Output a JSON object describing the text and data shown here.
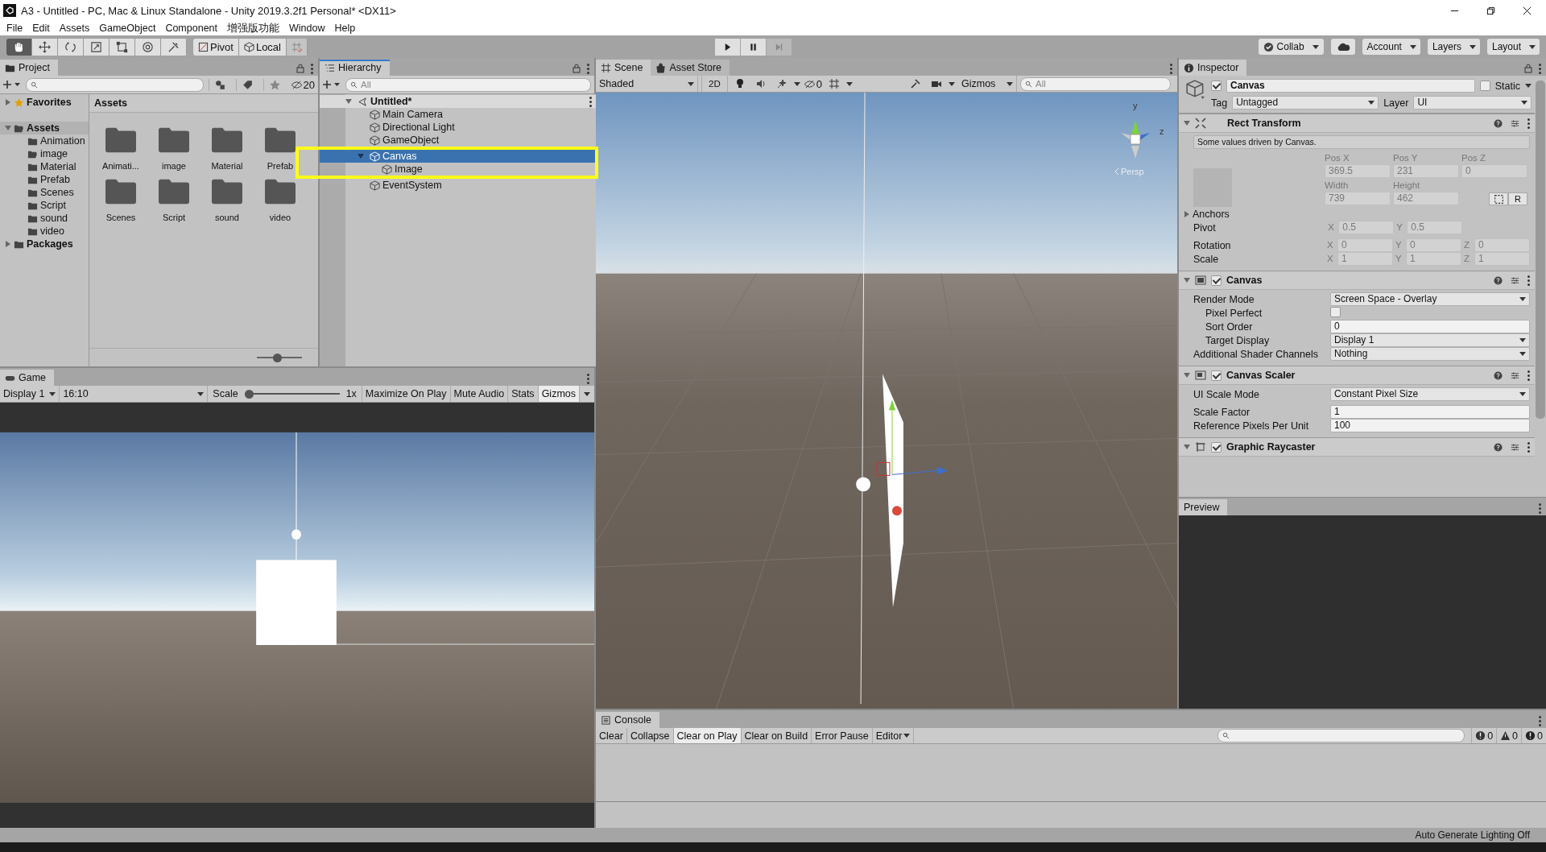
{
  "window": {
    "title": "A3 - Untitled - PC, Mac & Linux Standalone - Unity 2019.3.2f1 Personal* <DX11>"
  },
  "menu": [
    "File",
    "Edit",
    "Assets",
    "GameObject",
    "Component",
    "增强版功能",
    "Window",
    "Help"
  ],
  "toolbar": {
    "tools": [
      {
        "kind": "hand",
        "selected": true
      },
      {
        "kind": "move",
        "selected": false
      },
      {
        "kind": "rotate",
        "selected": false
      },
      {
        "kind": "scale",
        "selected": false
      },
      {
        "kind": "rect",
        "selected": false
      },
      {
        "kind": "transform",
        "selected": false
      },
      {
        "kind": "custom",
        "selected": false
      }
    ],
    "handles": [
      {
        "kind": "pivot",
        "label": "Pivot"
      },
      {
        "kind": "local",
        "label": "Local"
      }
    ],
    "snap": {
      "disabled": true
    },
    "play": [
      {
        "kind": "play",
        "disabled": false
      },
      {
        "kind": "pause",
        "disabled": false
      },
      {
        "kind": "step",
        "disabled": true
      }
    ],
    "right": [
      {
        "kind": "collab",
        "label": "Collab"
      },
      {
        "kind": "cloud"
      },
      {
        "kind": "dropdown",
        "label": "Account"
      },
      {
        "kind": "dropdown",
        "label": "Layers"
      },
      {
        "kind": "dropdown",
        "label": "Layout"
      }
    ]
  },
  "project": {
    "tab": "Project",
    "hidden_count": "20",
    "sidebar": [
      {
        "label": "Favorites",
        "kind": "favorites",
        "expanded": false,
        "selected": false
      },
      {
        "label": "Assets",
        "kind": "folder",
        "expanded": true,
        "selected": true,
        "children": [
          {
            "label": "Animation",
            "kind": "folder",
            "selected": false
          },
          {
            "label": "image",
            "kind": "open-folder",
            "selected": false
          },
          {
            "label": "Material",
            "kind": "folder",
            "selected": false
          },
          {
            "label": "Prefab",
            "kind": "folder",
            "selected": false
          },
          {
            "label": "Scenes",
            "kind": "folder",
            "selected": false
          },
          {
            "label": "Script",
            "kind": "folder",
            "selected": false
          },
          {
            "label": "sound",
            "kind": "folder",
            "selected": false
          },
          {
            "label": "video",
            "kind": "folder",
            "selected": false
          }
        ]
      },
      {
        "label": "Packages",
        "kind": "folder",
        "expanded": false,
        "selected": false
      }
    ],
    "breadcrumb": "Assets",
    "items": [
      "Animati...",
      "image",
      "Material",
      "Prefab",
      "Scenes",
      "Script",
      "sound",
      "video"
    ],
    "zoom": {
      "level": 0.45
    }
  },
  "hierarchy": {
    "tab": "Hierarchy",
    "search_placeholder": "All",
    "tree": [
      {
        "label": "Untitled*",
        "kind": "scene",
        "expanded": true,
        "selected": false,
        "children": [
          {
            "label": "Main Camera",
            "kind": "object",
            "selected": false
          },
          {
            "label": "Directional Light",
            "kind": "object",
            "selected": false
          },
          {
            "label": "GameObject",
            "kind": "object",
            "selected": false
          },
          {
            "label": "Canvas",
            "kind": "object",
            "selected": true,
            "expanded": true,
            "children": [
              {
                "label": "Image",
                "kind": "object",
                "selected": false
              }
            ]
          },
          {
            "label": "EventSystem",
            "kind": "object",
            "selected": false
          }
        ]
      }
    ]
  },
  "scene": {
    "tabs": [
      {
        "label": "Scene",
        "kind": "scene",
        "selected": true
      },
      {
        "label": "Asset Store",
        "kind": "store",
        "selected": false
      }
    ],
    "shading": "Shaded",
    "mode_2d": {
      "label": "2D",
      "selected": false
    },
    "hidden_count": "0",
    "gizmos": "Gizmos",
    "search_placeholder": "All",
    "persp": "Persp",
    "axes": [
      "y",
      "z"
    ]
  },
  "game": {
    "tab": "Game",
    "display": "Display 1",
    "aspect": "16:10",
    "scale_label": "Scale",
    "scale": {
      "level": 0.0
    },
    "scale_value": "1x",
    "toggles": [
      {
        "label": "Maximize On Play",
        "selected": false
      },
      {
        "label": "Mute Audio",
        "selected": false
      },
      {
        "label": "Stats",
        "selected": false
      },
      {
        "label": "Gizmos",
        "selected": true
      }
    ]
  },
  "inspector": {
    "tab": "Inspector",
    "object": {
      "active": true,
      "name": "Canvas",
      "static_label": "Static",
      "static": false,
      "tag_label": "Tag",
      "tag": "Untagged",
      "layer_label": "Layer",
      "layer": "UI"
    },
    "rect_transform": {
      "title": "Rect Transform",
      "expanded": true,
      "driven": true,
      "note": "Some values driven by Canvas.",
      "pos": [
        {
          "label": "Pos X",
          "value": "369.5"
        },
        {
          "label": "Pos Y",
          "value": "231"
        },
        {
          "label": "Pos Z",
          "value": "0"
        }
      ],
      "size": [
        {
          "label": "Width",
          "value": "739"
        },
        {
          "label": "Height",
          "value": "462"
        }
      ],
      "raw_button": "R",
      "anchors": "Anchors",
      "rows": [
        {
          "label": "Pivot",
          "axes": [
            {
              "axis": "X",
              "value": "0.5"
            },
            {
              "axis": "Y",
              "value": "0.5"
            }
          ]
        },
        {
          "label": "Rotation",
          "axes": [
            {
              "axis": "X",
              "value": "0"
            },
            {
              "axis": "Y",
              "value": "0"
            },
            {
              "axis": "Z",
              "value": "0"
            }
          ]
        },
        {
          "label": "Scale",
          "axes": [
            {
              "axis": "X",
              "value": "1"
            },
            {
              "axis": "Y",
              "value": "1"
            },
            {
              "axis": "Z",
              "value": "1"
            }
          ]
        }
      ]
    },
    "components": [
      {
        "title": "Canvas",
        "kind": "canvas",
        "enabled": true,
        "expanded": true,
        "rows": [
          {
            "kind": "dropdown",
            "label": "Render Mode",
            "value": "Screen Space - Overlay",
            "children": [
              {
                "kind": "checkbox",
                "label": "Pixel Perfect",
                "checked": false
              },
              {
                "kind": "text",
                "label": "Sort Order",
                "value": "0"
              },
              {
                "kind": "dropdown",
                "label": "Target Display",
                "value": "Display 1"
              }
            ]
          },
          {
            "kind": "dropdown",
            "label": "Additional Shader Channels",
            "value": "Nothing"
          }
        ]
      },
      {
        "title": "Canvas Scaler",
        "kind": "scaler",
        "enabled": true,
        "expanded": true,
        "rows": [
          {
            "kind": "dropdown",
            "label": "UI Scale Mode",
            "value": "Constant Pixel Size"
          },
          {
            "kind": "text",
            "label": "Scale Factor",
            "value": "1"
          },
          {
            "kind": "text",
            "label": "Reference Pixels Per Unit",
            "value": "100"
          }
        ]
      },
      {
        "title": "Graphic Raycaster",
        "kind": "raycaster",
        "enabled": true,
        "expanded": true
      }
    ],
    "preview": "Preview"
  },
  "console": {
    "tab": "Console",
    "buttons": [
      {
        "label": "Clear",
        "kind": "button",
        "selected": false
      },
      {
        "label": "Collapse",
        "kind": "toggle",
        "selected": false
      },
      {
        "label": "Clear on Play",
        "kind": "toggle",
        "selected": true
      },
      {
        "label": "Clear on Build",
        "kind": "toggle",
        "selected": false
      },
      {
        "label": "Error Pause",
        "kind": "toggle",
        "selected": false
      },
      {
        "label": "Editor",
        "kind": "dropdown",
        "selected": false
      }
    ],
    "counts": [
      {
        "kind": "info",
        "value": "0"
      },
      {
        "kind": "warning",
        "value": "0"
      },
      {
        "kind": "error",
        "value": "0"
      }
    ]
  },
  "status_bar": {
    "text": "Auto Generate Lighting Off"
  }
}
